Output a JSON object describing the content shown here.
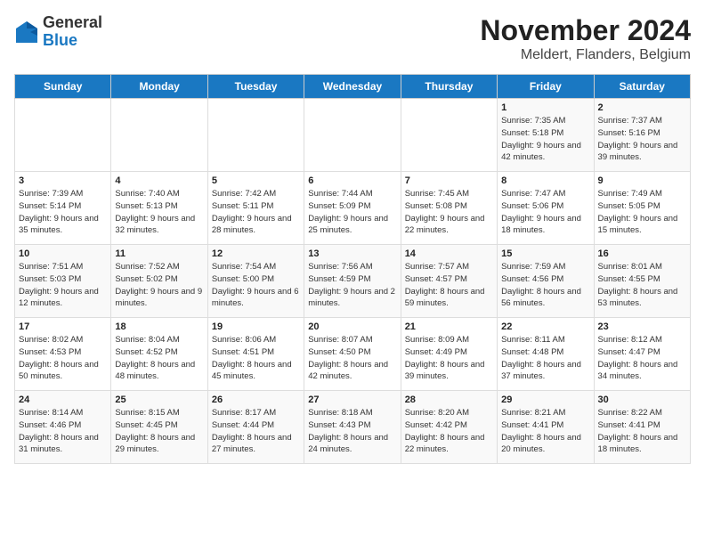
{
  "logo": {
    "line1": "General",
    "line2": "Blue"
  },
  "title": "November 2024",
  "subtitle": "Meldert, Flanders, Belgium",
  "days_of_week": [
    "Sunday",
    "Monday",
    "Tuesday",
    "Wednesday",
    "Thursday",
    "Friday",
    "Saturday"
  ],
  "weeks": [
    [
      {
        "day": "",
        "info": ""
      },
      {
        "day": "",
        "info": ""
      },
      {
        "day": "",
        "info": ""
      },
      {
        "day": "",
        "info": ""
      },
      {
        "day": "",
        "info": ""
      },
      {
        "day": "1",
        "info": "Sunrise: 7:35 AM\nSunset: 5:18 PM\nDaylight: 9 hours and 42 minutes."
      },
      {
        "day": "2",
        "info": "Sunrise: 7:37 AM\nSunset: 5:16 PM\nDaylight: 9 hours and 39 minutes."
      }
    ],
    [
      {
        "day": "3",
        "info": "Sunrise: 7:39 AM\nSunset: 5:14 PM\nDaylight: 9 hours and 35 minutes."
      },
      {
        "day": "4",
        "info": "Sunrise: 7:40 AM\nSunset: 5:13 PM\nDaylight: 9 hours and 32 minutes."
      },
      {
        "day": "5",
        "info": "Sunrise: 7:42 AM\nSunset: 5:11 PM\nDaylight: 9 hours and 28 minutes."
      },
      {
        "day": "6",
        "info": "Sunrise: 7:44 AM\nSunset: 5:09 PM\nDaylight: 9 hours and 25 minutes."
      },
      {
        "day": "7",
        "info": "Sunrise: 7:45 AM\nSunset: 5:08 PM\nDaylight: 9 hours and 22 minutes."
      },
      {
        "day": "8",
        "info": "Sunrise: 7:47 AM\nSunset: 5:06 PM\nDaylight: 9 hours and 18 minutes."
      },
      {
        "day": "9",
        "info": "Sunrise: 7:49 AM\nSunset: 5:05 PM\nDaylight: 9 hours and 15 minutes."
      }
    ],
    [
      {
        "day": "10",
        "info": "Sunrise: 7:51 AM\nSunset: 5:03 PM\nDaylight: 9 hours and 12 minutes."
      },
      {
        "day": "11",
        "info": "Sunrise: 7:52 AM\nSunset: 5:02 PM\nDaylight: 9 hours and 9 minutes."
      },
      {
        "day": "12",
        "info": "Sunrise: 7:54 AM\nSunset: 5:00 PM\nDaylight: 9 hours and 6 minutes."
      },
      {
        "day": "13",
        "info": "Sunrise: 7:56 AM\nSunset: 4:59 PM\nDaylight: 9 hours and 2 minutes."
      },
      {
        "day": "14",
        "info": "Sunrise: 7:57 AM\nSunset: 4:57 PM\nDaylight: 8 hours and 59 minutes."
      },
      {
        "day": "15",
        "info": "Sunrise: 7:59 AM\nSunset: 4:56 PM\nDaylight: 8 hours and 56 minutes."
      },
      {
        "day": "16",
        "info": "Sunrise: 8:01 AM\nSunset: 4:55 PM\nDaylight: 8 hours and 53 minutes."
      }
    ],
    [
      {
        "day": "17",
        "info": "Sunrise: 8:02 AM\nSunset: 4:53 PM\nDaylight: 8 hours and 50 minutes."
      },
      {
        "day": "18",
        "info": "Sunrise: 8:04 AM\nSunset: 4:52 PM\nDaylight: 8 hours and 48 minutes."
      },
      {
        "day": "19",
        "info": "Sunrise: 8:06 AM\nSunset: 4:51 PM\nDaylight: 8 hours and 45 minutes."
      },
      {
        "day": "20",
        "info": "Sunrise: 8:07 AM\nSunset: 4:50 PM\nDaylight: 8 hours and 42 minutes."
      },
      {
        "day": "21",
        "info": "Sunrise: 8:09 AM\nSunset: 4:49 PM\nDaylight: 8 hours and 39 minutes."
      },
      {
        "day": "22",
        "info": "Sunrise: 8:11 AM\nSunset: 4:48 PM\nDaylight: 8 hours and 37 minutes."
      },
      {
        "day": "23",
        "info": "Sunrise: 8:12 AM\nSunset: 4:47 PM\nDaylight: 8 hours and 34 minutes."
      }
    ],
    [
      {
        "day": "24",
        "info": "Sunrise: 8:14 AM\nSunset: 4:46 PM\nDaylight: 8 hours and 31 minutes."
      },
      {
        "day": "25",
        "info": "Sunrise: 8:15 AM\nSunset: 4:45 PM\nDaylight: 8 hours and 29 minutes."
      },
      {
        "day": "26",
        "info": "Sunrise: 8:17 AM\nSunset: 4:44 PM\nDaylight: 8 hours and 27 minutes."
      },
      {
        "day": "27",
        "info": "Sunrise: 8:18 AM\nSunset: 4:43 PM\nDaylight: 8 hours and 24 minutes."
      },
      {
        "day": "28",
        "info": "Sunrise: 8:20 AM\nSunset: 4:42 PM\nDaylight: 8 hours and 22 minutes."
      },
      {
        "day": "29",
        "info": "Sunrise: 8:21 AM\nSunset: 4:41 PM\nDaylight: 8 hours and 20 minutes."
      },
      {
        "day": "30",
        "info": "Sunrise: 8:22 AM\nSunset: 4:41 PM\nDaylight: 8 hours and 18 minutes."
      }
    ]
  ]
}
